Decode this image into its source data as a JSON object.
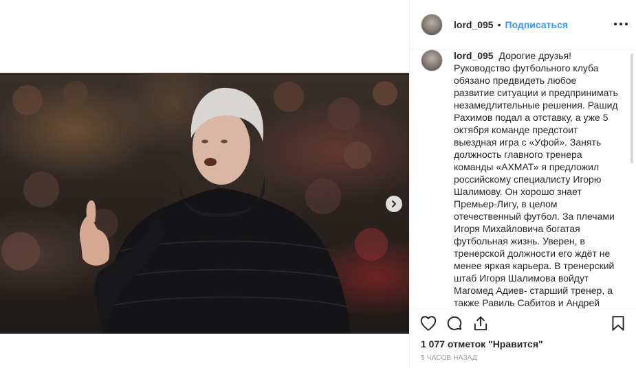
{
  "post": {
    "username": "lord_095",
    "separator": "•",
    "follow_label": "Подписаться",
    "caption_text": "Дорогие друзья! Руководство футбольного клуба обязано предвидеть любое развитие ситуации и предпринимать незамедлительные решения. Рашид Рахимов подал а отставку, а уже 5 октября команде предстоит выездная игра с «Уфой». Занять должность главного тренера команды «АХМАТ» я предложил российскому специалисту Игорю Шалимову. Он хорошо знает Премьер-Лигу, в целом отечественный футбол. За плечами Игоря Михайловича богатая футбольная жизнь. Уверен, в тренерской должности его ждёт не менее яркая карьера. В тренерский штаб Игоря Шалимова войдут Магомед Адиев- старший тренер, а также Равиль Сабитов и Андрей Митин. В сложившейся ситуации.",
    "likes_text": "1 077 отметок \"Нравится\"",
    "time_text": "5 ЧАСОВ НАЗАД"
  },
  "icons": {
    "like": "heart-icon",
    "comment": "comment-icon",
    "share": "share-icon",
    "save": "bookmark-icon",
    "more": "more-options-icon",
    "next": "chevron-right-icon"
  },
  "colors": {
    "link_blue": "#3897f0",
    "text": "#262626",
    "muted": "#999999",
    "border": "#efefef"
  }
}
